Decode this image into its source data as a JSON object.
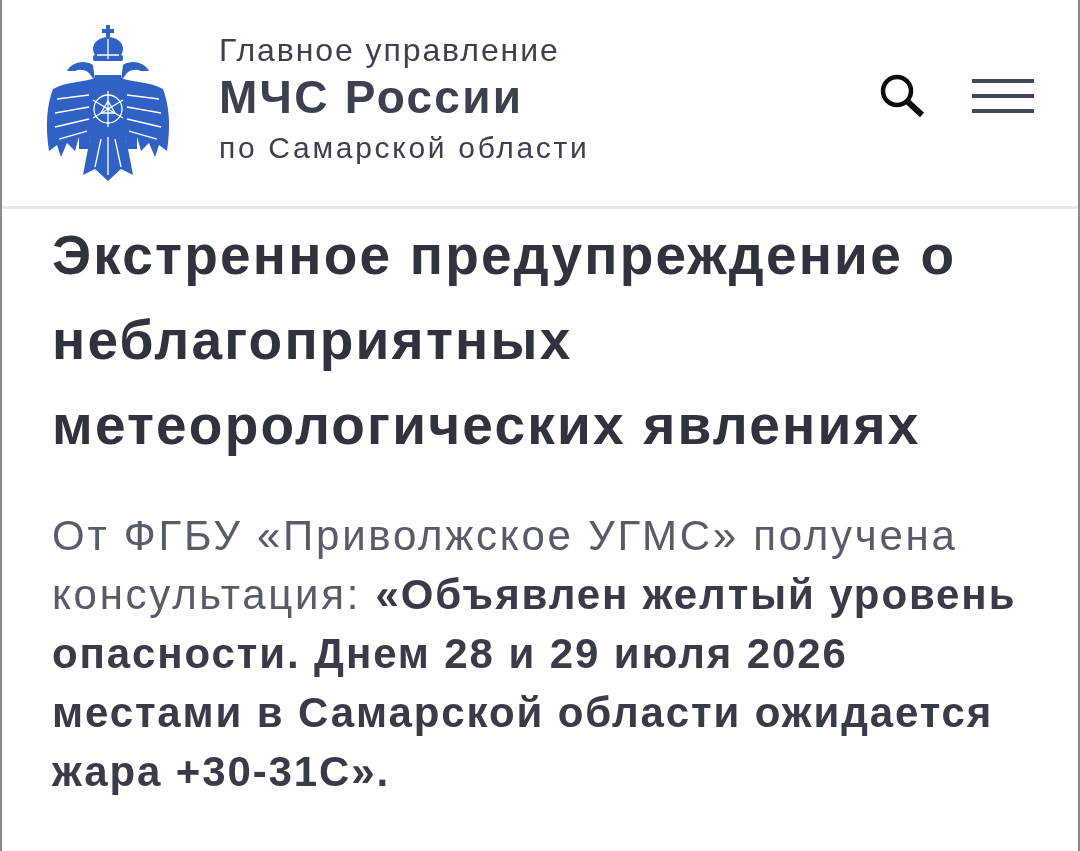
{
  "header": {
    "org_line_1": "Главное управление",
    "org_line_2": "МЧС России",
    "org_line_3": "по Самарской области"
  },
  "article": {
    "title": "Экстренное предупреждение о неблагоприятных метеорологических явлениях",
    "body": "От ФГБУ «Приволжское УГМС» получена консультация: **«Объявлен желтый уровень опасности. Днем 28 и 29 июля 2026 местами в Самарской области ожидается жара +30-31С».**"
  }
}
